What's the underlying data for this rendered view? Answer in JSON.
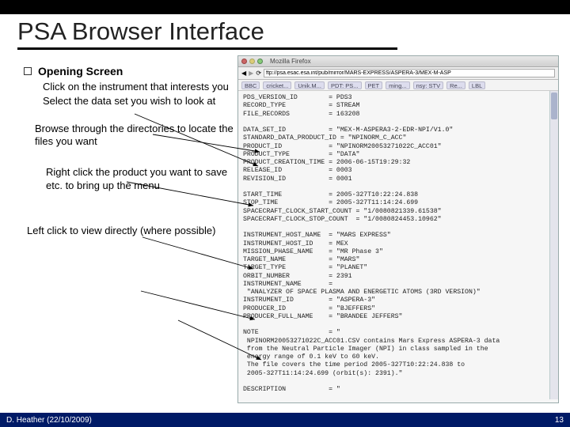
{
  "slide": {
    "title": "PSA Browser Interface",
    "bullet_heading": "Opening Screen",
    "sub1": "Click on the instrument that interests you",
    "sub2": "Select the data set you wish to look at",
    "para_browse": "Browse through the directories to locate the files you want",
    "para_right": "Right click the product you want to save etc. to bring up the menu",
    "para_left": "Left click to view directly (where possible)"
  },
  "screenshot": {
    "app_title": "Mozilla Firefox",
    "url": "ftp://psa.esac.esa.int/pub/mirror/MARS-EXPRESS/ASPERA-3/MEX-M-ASP",
    "tabs": [
      "BBC",
      "cricket...",
      "Unik.M...",
      "PDT: PS...",
      "PET",
      "ming...",
      "nsy: STV",
      "Re...",
      "LBL"
    ],
    "contents": "PDS_VERSION_ID        = PDS3\nRECORD_TYPE           = STREAM\nFILE_RECORDS          = 163208\n\nDATA_SET_ID           = \"MEX-M-ASPERA3-2-EDR-NPI/V1.0\"\nSTANDARD_DATA_PRODUCT_ID = \"NPINORM_C_ACC\"\nPRODUCT_ID            = \"NPINORM20053271022C_ACC01\"\nPRODUCT_TYPE          = \"DATA\"\nPRODUCT_CREATION_TIME = 2006-06-15T19:29:32\nRELEASE_ID            = 0003\nREVISION_ID           = 0001\n\nSTART_TIME            = 2005-327T10:22:24.838\nSTOP_TIME             = 2005-327T11:14:24.699\nSPACECRAFT_CLOCK_START_COUNT = \"1/0080821339.61538\"\nSPACECRAFT_CLOCK_STOP_COUNT  = \"1/0080824453.10962\"\n\nINSTRUMENT_HOST_NAME  = \"MARS EXPRESS\"\nINSTRUMENT_HOST_ID    = MEX\nMISSION_PHASE_NAME    = \"MR Phase 3\"\nTARGET_NAME           = \"MARS\"\nTARGET_TYPE           = \"PLANET\"\nORBIT_NUMBER          = 2391\nINSTRUMENT_NAME       =\n \"ANALYZER OF SPACE PLASMA AND ENERGETIC ATOMS (3RD VERSION)\"\nINSTRUMENT_ID         = \"ASPERA-3\"\nPRODUCER_ID           = \"BJEFFERS\"\nPRODUCER_FULL_NAME    = \"BRANDEE JEFFERS\"\n\nNOTE                  = \"\n NPINORM20053271022C_ACC01.CSV contains Mars Express ASPERA-3 data\n from the Neutral Particle Imager (NPI) in class sampled in the\n energy range of 0.1 keV to 60 keV.\n The file covers the time period 2005-327T10:22:24.838 to\n 2005-327T11:14:24.699 (orbit(s): 2391).\"\n\nDESCRIPTION           = \"\n This file contains data for NPINORM, the Neutral Particle Imager (NPI)\n instrument mode (NORM). There are 32 azimuthal sectors and\n data are sampled in the energy range of 0.1 keV to 60 keV. Each row\n contains a singular value (SENSOR) in class corresponding to one\n of the 32 azimuthal sectors, followed by a data quality indicator.\n The NPI instrument is stationary (not rotating) for this mode. The\n ASPERA-3 scanning units parked and has not yet been turned on.\n Please refer to the Data Set Catalog, ASPERA3_NPI_EDR_DS.CAT,\n for detailed information about data organization, science meaning,\n data quality considerations, data usage, etc.\"\n\n^SPREADSHEET          = \"NPINORM20053271022C_ACC01.CSV\"\n\n- OPE, Optical Probe Experiment (PI: A. Weisenberger)\n- PIA, Particle Impact Analyzer (PI: J. Kissel)\n- RPA, Copernic Plasma Experiment"
  },
  "footer": {
    "author": "D. Heather (22/10/2009)",
    "page": "13"
  }
}
